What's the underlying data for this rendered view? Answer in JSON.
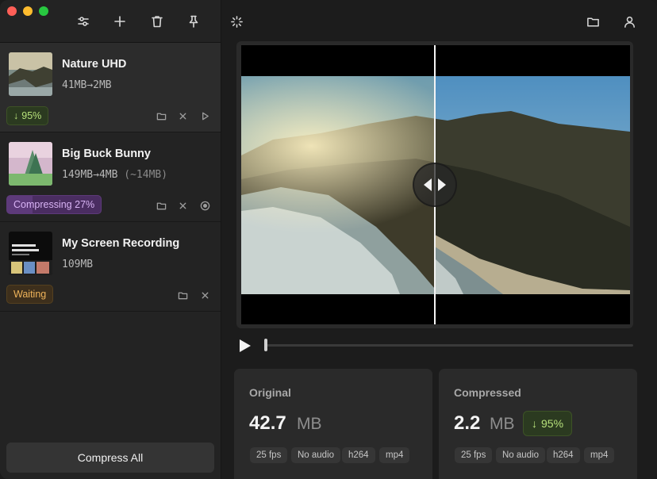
{
  "sidebar": {
    "toolbar": {
      "icons": [
        "sliders-icon",
        "plus-icon",
        "trash-icon",
        "pin-icon"
      ]
    },
    "items": [
      {
        "title": "Nature UHD",
        "size_from": "41MB",
        "size_to": "2MB",
        "size_estimate": "",
        "badge": "95%",
        "badge_color": "#b6e07a"
      },
      {
        "title": "Big Buck Bunny",
        "size_from": "149MB",
        "size_to": "4MB",
        "size_estimate": "(~14MB)",
        "badge": "Compressing 27%",
        "badge_color": "#d9b4f5",
        "progress": 0.27
      },
      {
        "title": "My Screen Recording",
        "size_from": "109MB",
        "size_to": "",
        "size_estimate": "",
        "badge": "Waiting",
        "badge_color": "#f0b45a"
      }
    ],
    "compress_all_label": "Compress All"
  },
  "main": {
    "toolbar_icons": [
      "spinner-icon",
      "folder-icon",
      "person-icon"
    ],
    "original": {
      "title": "Original",
      "size": "42.7",
      "unit": "MB",
      "chips": [
        "25 fps",
        "No audio",
        "h264",
        "mp4"
      ]
    },
    "compressed": {
      "title": "Compressed",
      "size": "2.2",
      "unit": "MB",
      "badge": "95%",
      "chips": [
        "25 fps",
        "No audio",
        "h264",
        "mp4"
      ]
    },
    "playback_position": 0.0
  },
  "colors": {
    "accent_green": "#b6e07a",
    "accent_purple": "#d9b4f5",
    "accent_orange": "#f0b45a",
    "traffic_red": "#ff5f57",
    "traffic_yellow": "#febc2e",
    "traffic_green": "#28c840"
  }
}
